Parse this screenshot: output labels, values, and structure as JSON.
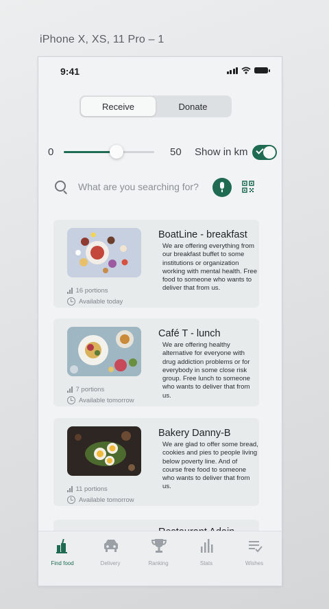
{
  "artboard": {
    "title": "iPhone X, XS, 11 Pro – 1"
  },
  "status_bar": {
    "time": "9:41"
  },
  "segmented_control": {
    "options": [
      "Receive",
      "Donate"
    ],
    "selected": "Receive"
  },
  "distance_filter": {
    "min_label": "0",
    "max_label": "50",
    "unit_label": "Show in km",
    "value_fraction": 0.58,
    "toggle_on": true
  },
  "search": {
    "placeholder": "What are you searching for?",
    "value": ""
  },
  "listings": [
    {
      "title": "BoatLine - breakfast",
      "description": "We are offering everything from our breakfast buffet to some institutions or organization working with mental health. Free food to someone who wants to deliver that from us.",
      "portions": "16 portions",
      "availability": "Available today"
    },
    {
      "title": "Café T - lunch",
      "description": "We are offering healthy alternative for everyone with drug addiction problems or for everybody in some close risk group. Free lunch to someone who wants to deliver that from us.",
      "portions": "7 portions",
      "availability": "Available tomorrow"
    },
    {
      "title": "Bakery Danny-B",
      "description": "We are glad to offer some bread, cookies and pies to people living below poverty line. And of course free food to someone who wants to deliver that from us.",
      "portions": "11 portions",
      "availability": "Available tomorrow"
    },
    {
      "title": "Restaurant Adain"
    }
  ],
  "tab_bar": {
    "items": [
      {
        "label": "Find food",
        "icon": "find-food-icon"
      },
      {
        "label": "Delivery",
        "icon": "car-icon"
      },
      {
        "label": "Ranking",
        "icon": "trophy-icon"
      },
      {
        "label": "Stats",
        "icon": "stats-icon"
      },
      {
        "label": "Wishes",
        "icon": "wishlist-icon"
      }
    ],
    "active": "Find food"
  },
  "colors": {
    "accent": "#1f6b52",
    "card_bg": "#e7ebec",
    "muted_text": "#9aa0a5"
  }
}
